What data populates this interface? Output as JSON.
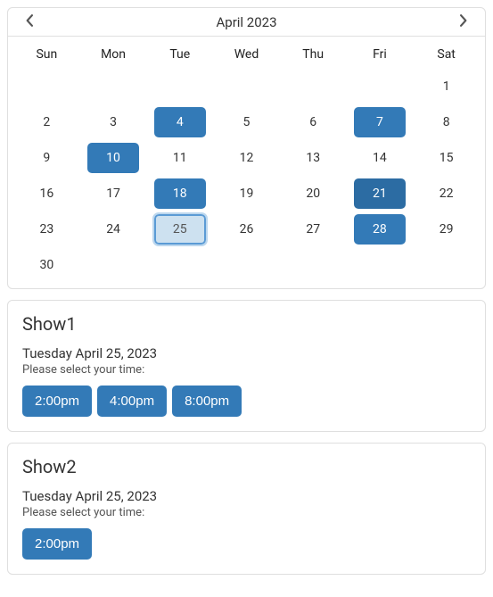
{
  "calendar": {
    "month_title": "April 2023",
    "weekdays": [
      "Sun",
      "Mon",
      "Tue",
      "Wed",
      "Thu",
      "Fri",
      "Sat"
    ],
    "leading_blanks": 6,
    "days": [
      {
        "num": 1,
        "state": "plain"
      },
      {
        "num": 2,
        "state": "plain"
      },
      {
        "num": 3,
        "state": "plain"
      },
      {
        "num": 4,
        "state": "available"
      },
      {
        "num": 5,
        "state": "plain"
      },
      {
        "num": 6,
        "state": "plain"
      },
      {
        "num": 7,
        "state": "available"
      },
      {
        "num": 8,
        "state": "plain"
      },
      {
        "num": 9,
        "state": "plain"
      },
      {
        "num": 10,
        "state": "available"
      },
      {
        "num": 11,
        "state": "plain"
      },
      {
        "num": 12,
        "state": "plain"
      },
      {
        "num": 13,
        "state": "plain"
      },
      {
        "num": 14,
        "state": "plain"
      },
      {
        "num": 15,
        "state": "plain"
      },
      {
        "num": 16,
        "state": "plain"
      },
      {
        "num": 17,
        "state": "plain"
      },
      {
        "num": 18,
        "state": "available"
      },
      {
        "num": 19,
        "state": "plain"
      },
      {
        "num": 20,
        "state": "plain"
      },
      {
        "num": 21,
        "state": "unavailable"
      },
      {
        "num": 22,
        "state": "plain"
      },
      {
        "num": 23,
        "state": "plain"
      },
      {
        "num": 24,
        "state": "plain"
      },
      {
        "num": 25,
        "state": "selected"
      },
      {
        "num": 26,
        "state": "plain"
      },
      {
        "num": 27,
        "state": "plain"
      },
      {
        "num": 28,
        "state": "available"
      },
      {
        "num": 29,
        "state": "plain"
      },
      {
        "num": 30,
        "state": "plain"
      }
    ]
  },
  "shows": [
    {
      "title": "Show1",
      "date_text": "Tuesday April 25, 2023",
      "instruction": "Please select your time:",
      "times": [
        "2:00pm",
        "4:00pm",
        "8:00pm"
      ]
    },
    {
      "title": "Show2",
      "date_text": "Tuesday April 25, 2023",
      "instruction": "Please select your time:",
      "times": [
        "2:00pm"
      ]
    }
  ],
  "colors": {
    "available_bg": "#337ab7",
    "unavailable_bg": "#2c6ca3",
    "selected_bg": "#cde1f0",
    "selected_border": "#5b9bd5"
  }
}
